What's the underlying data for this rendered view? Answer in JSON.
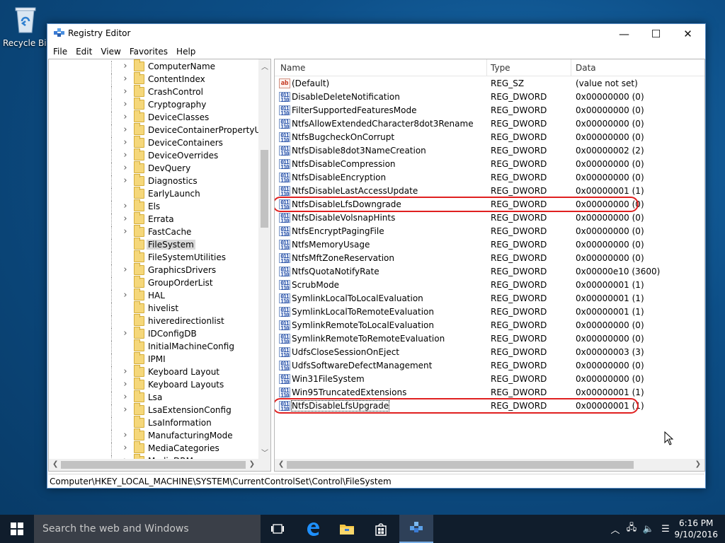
{
  "desktop": {
    "recycle_bin_label": "Recycle Bin"
  },
  "window": {
    "title": "Registry Editor",
    "minimize": "—",
    "maximize": "☐",
    "close": "✕"
  },
  "menu": [
    "File",
    "Edit",
    "View",
    "Favorites",
    "Help"
  ],
  "tree": {
    "items": [
      {
        "label": "ComputerName",
        "expandable": true
      },
      {
        "label": "ContentIndex",
        "expandable": true
      },
      {
        "label": "CrashControl",
        "expandable": true
      },
      {
        "label": "Cryptography",
        "expandable": true
      },
      {
        "label": "DeviceClasses",
        "expandable": true
      },
      {
        "label": "DeviceContainerPropertyUpda",
        "expandable": true
      },
      {
        "label": "DeviceContainers",
        "expandable": true
      },
      {
        "label": "DeviceOverrides",
        "expandable": true
      },
      {
        "label": "DevQuery",
        "expandable": true
      },
      {
        "label": "Diagnostics",
        "expandable": true
      },
      {
        "label": "EarlyLaunch",
        "expandable": false
      },
      {
        "label": "Els",
        "expandable": true
      },
      {
        "label": "Errata",
        "expandable": true
      },
      {
        "label": "FastCache",
        "expandable": true
      },
      {
        "label": "FileSystem",
        "expandable": false,
        "selected": true
      },
      {
        "label": "FileSystemUtilities",
        "expandable": false
      },
      {
        "label": "GraphicsDrivers",
        "expandable": true
      },
      {
        "label": "GroupOrderList",
        "expandable": false
      },
      {
        "label": "HAL",
        "expandable": true
      },
      {
        "label": "hivelist",
        "expandable": false
      },
      {
        "label": "hiveredirectionlist",
        "expandable": false
      },
      {
        "label": "IDConfigDB",
        "expandable": true
      },
      {
        "label": "InitialMachineConfig",
        "expandable": false
      },
      {
        "label": "IPMI",
        "expandable": false
      },
      {
        "label": "Keyboard Layout",
        "expandable": true
      },
      {
        "label": "Keyboard Layouts",
        "expandable": true
      },
      {
        "label": "Lsa",
        "expandable": true
      },
      {
        "label": "LsaExtensionConfig",
        "expandable": true
      },
      {
        "label": "LsaInformation",
        "expandable": false
      },
      {
        "label": "ManufacturingMode",
        "expandable": true
      },
      {
        "label": "MediaCategories",
        "expandable": true
      },
      {
        "label": "MediaDRM",
        "expandable": true
      }
    ]
  },
  "list": {
    "columns": {
      "name": "Name",
      "type": "Type",
      "data": "Data"
    },
    "rows": [
      {
        "name": "(Default)",
        "type": "REG_SZ",
        "data": "(value not set)",
        "icon": "string"
      },
      {
        "name": "DisableDeleteNotification",
        "type": "REG_DWORD",
        "data": "0x00000000 (0)",
        "icon": "binary"
      },
      {
        "name": "FilterSupportedFeaturesMode",
        "type": "REG_DWORD",
        "data": "0x00000000 (0)",
        "icon": "binary"
      },
      {
        "name": "NtfsAllowExtendedCharacter8dot3Rename",
        "type": "REG_DWORD",
        "data": "0x00000000 (0)",
        "icon": "binary"
      },
      {
        "name": "NtfsBugcheckOnCorrupt",
        "type": "REG_DWORD",
        "data": "0x00000000 (0)",
        "icon": "binary"
      },
      {
        "name": "NtfsDisable8dot3NameCreation",
        "type": "REG_DWORD",
        "data": "0x00000002 (2)",
        "icon": "binary"
      },
      {
        "name": "NtfsDisableCompression",
        "type": "REG_DWORD",
        "data": "0x00000000 (0)",
        "icon": "binary"
      },
      {
        "name": "NtfsDisableEncryption",
        "type": "REG_DWORD",
        "data": "0x00000000 (0)",
        "icon": "binary"
      },
      {
        "name": "NtfsDisableLastAccessUpdate",
        "type": "REG_DWORD",
        "data": "0x00000001 (1)",
        "icon": "binary"
      },
      {
        "name": "NtfsDisableLfsDowngrade",
        "type": "REG_DWORD",
        "data": "0x00000000 (0)",
        "icon": "binary",
        "highlighted": true
      },
      {
        "name": "NtfsDisableVolsnapHints",
        "type": "REG_DWORD",
        "data": "0x00000000 (0)",
        "icon": "binary"
      },
      {
        "name": "NtfsEncryptPagingFile",
        "type": "REG_DWORD",
        "data": "0x00000000 (0)",
        "icon": "binary"
      },
      {
        "name": "NtfsMemoryUsage",
        "type": "REG_DWORD",
        "data": "0x00000000 (0)",
        "icon": "binary"
      },
      {
        "name": "NtfsMftZoneReservation",
        "type": "REG_DWORD",
        "data": "0x00000000 (0)",
        "icon": "binary"
      },
      {
        "name": "NtfsQuotaNotifyRate",
        "type": "REG_DWORD",
        "data": "0x00000e10 (3600)",
        "icon": "binary"
      },
      {
        "name": "ScrubMode",
        "type": "REG_DWORD",
        "data": "0x00000001 (1)",
        "icon": "binary"
      },
      {
        "name": "SymlinkLocalToLocalEvaluation",
        "type": "REG_DWORD",
        "data": "0x00000001 (1)",
        "icon": "binary"
      },
      {
        "name": "SymlinkLocalToRemoteEvaluation",
        "type": "REG_DWORD",
        "data": "0x00000001 (1)",
        "icon": "binary"
      },
      {
        "name": "SymlinkRemoteToLocalEvaluation",
        "type": "REG_DWORD",
        "data": "0x00000000 (0)",
        "icon": "binary"
      },
      {
        "name": "SymlinkRemoteToRemoteEvaluation",
        "type": "REG_DWORD",
        "data": "0x00000000 (0)",
        "icon": "binary"
      },
      {
        "name": "UdfsCloseSessionOnEject",
        "type": "REG_DWORD",
        "data": "0x00000003 (3)",
        "icon": "binary"
      },
      {
        "name": "UdfsSoftwareDefectManagement",
        "type": "REG_DWORD",
        "data": "0x00000000 (0)",
        "icon": "binary"
      },
      {
        "name": "Win31FileSystem",
        "type": "REG_DWORD",
        "data": "0x00000000 (0)",
        "icon": "binary"
      },
      {
        "name": "Win95TruncatedExtensions",
        "type": "REG_DWORD",
        "data": "0x00000001 (1)",
        "icon": "binary"
      },
      {
        "name": "NtfsDisableLfsUpgrade",
        "type": "REG_DWORD",
        "data": "0x00000001 (1)",
        "icon": "binary",
        "highlighted": true,
        "focused": true
      }
    ]
  },
  "statusbar": {
    "path": "Computer\\HKEY_LOCAL_MACHINE\\SYSTEM\\CurrentControlSet\\Control\\FileSystem"
  },
  "taskbar": {
    "search_placeholder": "Search the web and Windows",
    "time": "6:16 PM",
    "date": "9/10/2016"
  },
  "colors": {
    "highlight_oval": "#e02020",
    "taskbar": "#101d2c",
    "selection": "#d9d9d9"
  }
}
